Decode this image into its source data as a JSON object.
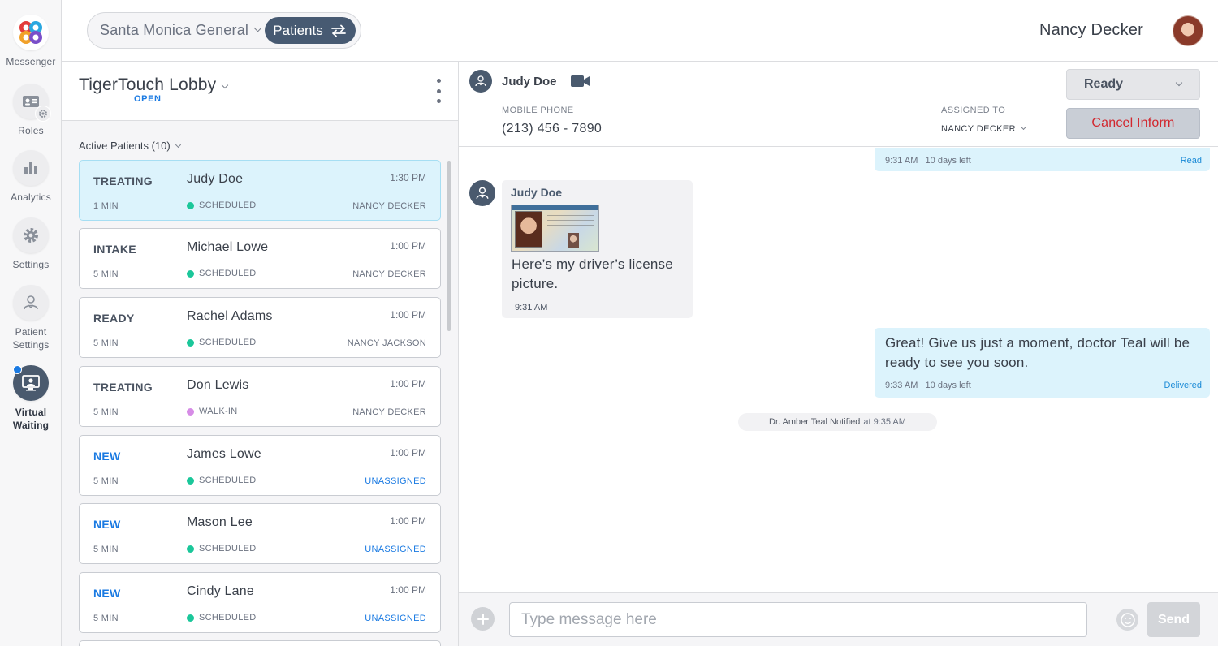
{
  "rail": {
    "items": [
      {
        "label": "Messenger",
        "icon": "messenger-logo-icon"
      },
      {
        "label": "Roles",
        "icon": "roles-icon"
      },
      {
        "label": "Analytics",
        "icon": "analytics-icon"
      },
      {
        "label": "Settings",
        "icon": "gear-icon"
      },
      {
        "label_line1": "Patient",
        "label_line2": "Settings",
        "icon": "patient-settings-icon"
      },
      {
        "label_line1": "Virtual",
        "label_line2": "Waiting",
        "icon": "virtual-waiting-icon",
        "active": true
      }
    ]
  },
  "topbar": {
    "org_name": "Santa Monica General",
    "mode_label": "Patients",
    "user_name": "Nancy Decker"
  },
  "lobby": {
    "title": "TigerTouch Lobby",
    "status": "OPEN",
    "active_label": "Active Patients (10)",
    "patients": [
      {
        "state": "TREATING",
        "name": "Judy Doe",
        "time": "1:30 PM",
        "wait": "1 MIN",
        "visit": "SCHEDULED",
        "assignee": "NANCY DECKER"
      },
      {
        "state": "INTAKE",
        "name": "Michael Lowe",
        "time": "1:00 PM",
        "wait": "5 MIN",
        "visit": "SCHEDULED",
        "assignee": "NANCY DECKER"
      },
      {
        "state": "READY",
        "name": "Rachel Adams",
        "time": "1:00 PM",
        "wait": "5 MIN",
        "visit": "SCHEDULED",
        "assignee": "NANCY JACKSON"
      },
      {
        "state": "TREATING",
        "name": "Don Lewis",
        "time": "1:00 PM",
        "wait": "5 MIN",
        "visit": "WALK-IN",
        "assignee": "NANCY DECKER"
      },
      {
        "state": "NEW",
        "name": "James Lowe",
        "time": "1:00 PM",
        "wait": "5 MIN",
        "visit": "SCHEDULED",
        "assignee": "UNASSIGNED"
      },
      {
        "state": "NEW",
        "name": "Mason Lee",
        "time": "1:00 PM",
        "wait": "5 MIN",
        "visit": "SCHEDULED",
        "assignee": "UNASSIGNED"
      },
      {
        "state": "NEW",
        "name": "Cindy Lane",
        "time": "1:00 PM",
        "wait": "5 MIN",
        "visit": "SCHEDULED",
        "assignee": "UNASSIGNED"
      }
    ]
  },
  "conversation": {
    "patient_name": "Judy Doe",
    "phone_label": "MOBILE PHONE",
    "phone": "(213) 456 - 7890",
    "assigned_label": "ASSIGNED TO",
    "assigned_to": "NANCY DECKER",
    "status": "Ready",
    "cancel_label": "Cancel Inform",
    "messages": {
      "top_out": {
        "time": "9:31 AM",
        "expiry": "10 days left",
        "receipt": "Read"
      },
      "incoming": {
        "sender": "Judy Doe",
        "text": "Here’s my driver’s license picture.",
        "time": "9:31 AM"
      },
      "outgoing": {
        "text": "Great! Give us just a moment, doctor Teal will be ready to see you soon.",
        "time": "9:33 AM",
        "expiry": "10 days left",
        "receipt": "Delivered"
      }
    },
    "notification": {
      "who": "Dr. Amber Teal Notified",
      "when": "at 9:35 AM"
    },
    "composer": {
      "placeholder": "Type message here",
      "send_label": "Send"
    }
  },
  "colors": {
    "accent_blue": "#1a7ae2",
    "rail_active": "#4a5a6e",
    "selected_card": "#dcf3fc",
    "danger": "#d2272e",
    "scheduled_dot": "#1bc79a",
    "walkin_dot": "#d68ce6"
  }
}
